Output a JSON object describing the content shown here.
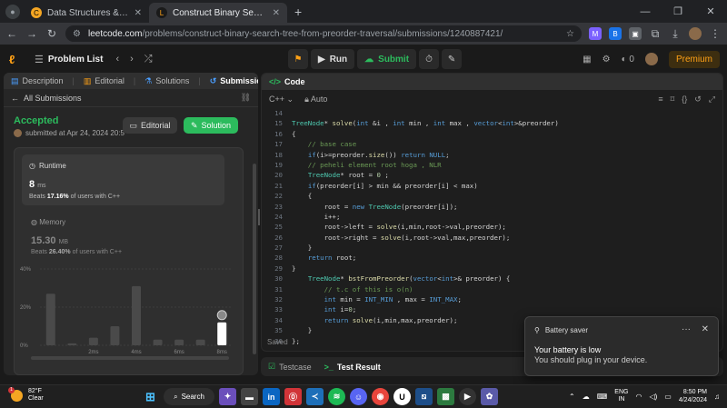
{
  "browser": {
    "tabs": [
      {
        "title": "Data Structures & Algorithms I",
        "favicon": "C",
        "favcolor": "#f5a623",
        "active": false
      },
      {
        "title": "Construct Binary Search Tree f",
        "favicon": "L",
        "favcolor": "#ffa116",
        "active": true
      }
    ],
    "url_host": "leetcode.com",
    "url_path": "/problems/construct-binary-search-tree-from-preorder-traversal/submissions/1240887421/"
  },
  "header": {
    "problem_list": "Problem List",
    "run": "Run",
    "submit": "Submit",
    "notif_count": "0",
    "premium": "Premium"
  },
  "left": {
    "tabs": [
      "Description",
      "Editorial",
      "Solutions",
      "Submissions"
    ],
    "all_submissions": "All Submissions",
    "status": "Accepted",
    "submitted_at": "submitted at Apr 24, 2024 20:5",
    "editorial_btn": "Editorial",
    "solution_btn": "Solution",
    "runtime_label": "Runtime",
    "runtime_value": "8",
    "runtime_unit": "ms",
    "runtime_beats_pre": "Beats",
    "runtime_beats": "17.16%",
    "runtime_beats_post": "of users with C++",
    "memory_label": "Memory",
    "memory_value": "15.30",
    "memory_unit": "MB",
    "memory_beats_pre": "Beats",
    "memory_beats": "26.40%",
    "memory_beats_post": "of users with C++"
  },
  "chart_data": {
    "type": "bar",
    "yticks": [
      "40%",
      "20%",
      "0%"
    ],
    "ylim": [
      0,
      40
    ],
    "xticks": [
      "2ms",
      "4ms",
      "6ms",
      "8ms"
    ],
    "values": [
      27,
      1,
      4,
      10,
      31,
      3,
      3,
      3,
      12
    ],
    "highlight_index": 8
  },
  "code": {
    "tab": "Code",
    "language": "C++",
    "mode": "Auto",
    "saved": "Saved",
    "lines": [
      {
        "n": "14",
        "t": ""
      },
      {
        "n": "15",
        "t": "TreeNode* solve(int &i , int min , int max , vector<int>&preorder)"
      },
      {
        "n": "16",
        "t": "{"
      },
      {
        "n": "17",
        "t": "    // base case"
      },
      {
        "n": "18",
        "t": "    if(i>=preorder.size()) return NULL;"
      },
      {
        "n": "19",
        "t": "    // peheli element root hoga , NLR"
      },
      {
        "n": "20",
        "t": "    TreeNode* root = 0 ;"
      },
      {
        "n": "21",
        "t": "    if(preorder[i] > min && preorder[i] < max)"
      },
      {
        "n": "22",
        "t": "    {"
      },
      {
        "n": "23",
        "t": "        root = new TreeNode(preorder[i]);"
      },
      {
        "n": "24",
        "t": "        i++;"
      },
      {
        "n": "25",
        "t": "        root->left = solve(i,min,root->val,preorder);"
      },
      {
        "n": "26",
        "t": "        root->right = solve(i,root->val,max,preorder);"
      },
      {
        "n": "27",
        "t": "    }"
      },
      {
        "n": "28",
        "t": "    return root;"
      },
      {
        "n": "29",
        "t": "}"
      },
      {
        "n": "30",
        "t": "    TreeNode* bstFromPreorder(vector<int>& preorder) {"
      },
      {
        "n": "31",
        "t": "        // t.c of this is o(n)"
      },
      {
        "n": "32",
        "t": "        int min = INT_MIN , max = INT_MAX;"
      },
      {
        "n": "33",
        "t": "        int i=0;"
      },
      {
        "n": "34",
        "t": "        return solve(i,min,max,preorder);"
      },
      {
        "n": "35",
        "t": "    }"
      },
      {
        "n": "36",
        "t": "};"
      }
    ]
  },
  "testpanel": {
    "testcase": "Testcase",
    "result": "Test Result"
  },
  "toast": {
    "title": "Battery saver",
    "line1": "Your battery is low",
    "line2": "You should plug in your device."
  },
  "taskbar": {
    "temp": "82°F",
    "condition": "Clear",
    "search": "Search",
    "lang1": "ENG",
    "lang2": "IN",
    "time": "8:50 PM",
    "date": "4/24/2024"
  }
}
